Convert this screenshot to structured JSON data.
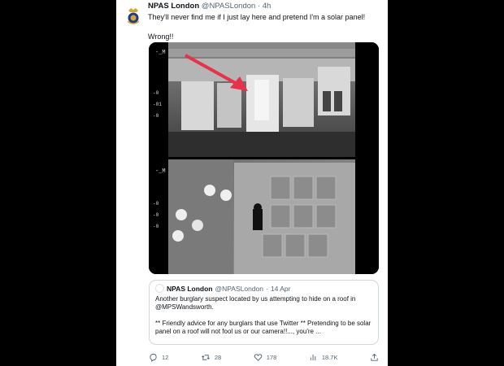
{
  "tweet": {
    "author_name": "NPAS London",
    "author_handle": "@NPASLondon",
    "separator": "·",
    "time": "4h",
    "text_line1": "They'll never find me if I just lay here and pretend I'm a solar panel!",
    "text_line2": "Wrong!!"
  },
  "quote": {
    "author_name": "NPAS London",
    "author_handle": "@NPASLondon",
    "separator": "·",
    "date": "14 Apr",
    "text_p1": "Another burglary suspect located by us attempting to hide on a roof in @MPSWandsworth.",
    "text_p2": "** Friendly advice for any burglars that use Twitter ** Pretending to be solar panel on a roof will not fool us or our camera!!..., you're ..."
  },
  "actions": {
    "replies": "12",
    "retweets": "28",
    "likes": "178",
    "views": "18.7K"
  },
  "icons": {
    "reply": "reply-icon",
    "retweet": "retweet-icon",
    "like": "heart-icon",
    "views": "bar-chart-icon",
    "share": "share-icon",
    "arrow_color": "#e8314a"
  },
  "overlay": {
    "top_ticks": [
      "-0",
      "-01",
      "-0"
    ],
    "bottom_ticks": [
      "-0",
      "-0",
      "-0"
    ]
  }
}
